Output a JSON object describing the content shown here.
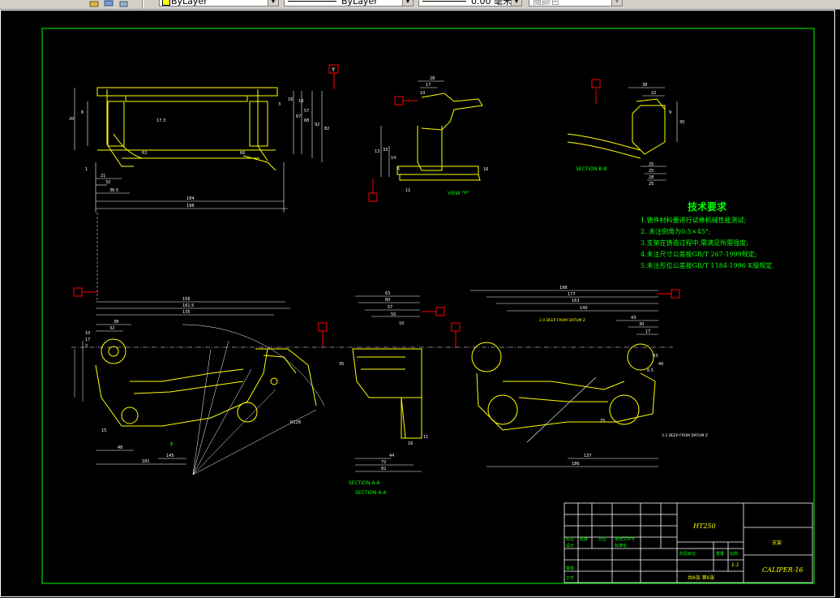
{
  "toolbar": {
    "layer_combo": "ByLayer",
    "linetype_combo": "ByLayer",
    "lineweight_combo": "0.00 毫米",
    "color_combo": "随颜色"
  },
  "drawing": {
    "tech_req_title": "技术要求",
    "tech_req": [
      "1.铸件材料要进行试棒机械性能测试;",
      "2. 未注倒角为0.5×45°;",
      "3.支架在铸造过程中,需满足所需强度;",
      "4.未注尺寸公差按GB/T 267-1999规定;",
      "5.未注形位公差按GB/T 1184-1996 K级规定."
    ],
    "section_bb": "SECTION B-B",
    "view_p": "VIEW \"P\"",
    "section_aa_1": "SECTION A-A",
    "section_aa_2": "SECTION A-A",
    "datum_label": "Y",
    "deep_note_1": "2.0 DEEP FROM DATUM Z",
    "deep_note_2": "3.3 DEEP FROM DATUM Z",
    "f_label": "F",
    "dims_top_left": [
      "184",
      "198",
      "36.5",
      "32",
      "21",
      "1",
      "20",
      "66",
      "82",
      "92",
      "68",
      "67",
      "57",
      "19",
      "16",
      "3",
      "6",
      "R1",
      "17.3"
    ],
    "dims_top_mid": [
      "28",
      "17",
      "10",
      "13",
      "33",
      "14",
      "5",
      "16",
      "11"
    ],
    "dims_top_right": [
      "38",
      "22",
      "9",
      "30",
      "25",
      "25",
      "28",
      "25"
    ],
    "dims_bottom_left": [
      "156",
      "161.5",
      "135",
      "38",
      "32",
      "15",
      "10",
      "17",
      "2",
      "48",
      "181",
      "145",
      "R128"
    ],
    "dims_bottom_mid": [
      "63",
      "60",
      "57",
      "50",
      "10",
      "35",
      "44",
      "72",
      "82",
      "16",
      "11"
    ],
    "dims_bottom_right": [
      "198",
      "177",
      "163",
      "140",
      "43",
      "30",
      "17",
      "33",
      "6.5",
      "40",
      "186",
      "137",
      "25"
    ]
  },
  "title_block": {
    "material": "HT250",
    "part_name": "支架",
    "drawing_no": "CALIPER-16",
    "sheet_info": "共6张 第6张",
    "scale": "1:1",
    "row_labels": [
      "标记",
      "处数",
      "分区",
      "更改文件号",
      "签名",
      "年月日"
    ],
    "designer": "设计",
    "standardization": "标准化",
    "checker": "审核",
    "process": "工艺",
    "approve": "批准",
    "stage_mark": "阶段标记",
    "weight": "重量",
    "ratio": "比例"
  },
  "colors": {
    "frame": "#00ff00",
    "geometry": "#ffff00",
    "dimensions": "#ffffff",
    "datum_box": "#ff0000",
    "notes": "#00ff00"
  }
}
